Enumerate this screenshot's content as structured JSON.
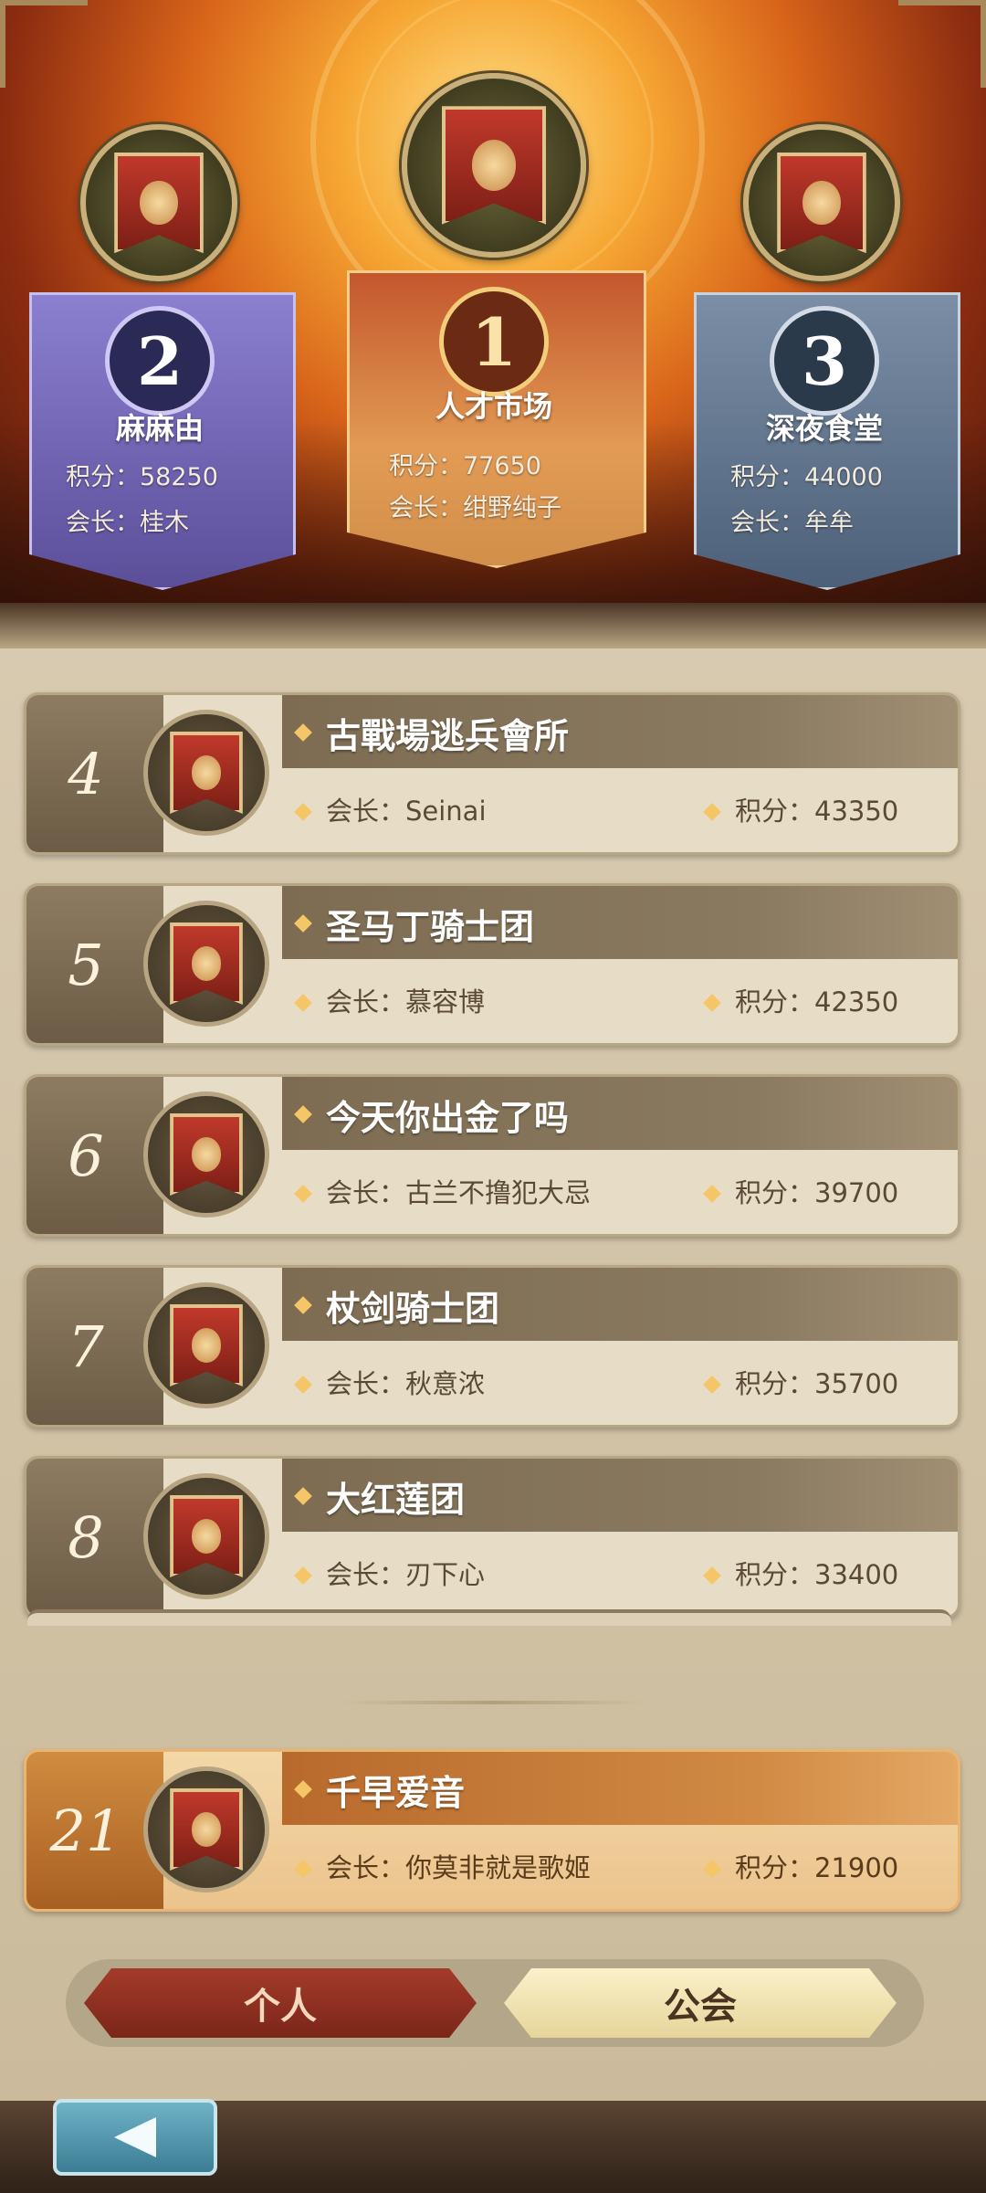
{
  "podium": [
    {
      "rank": "2",
      "name": "麻麻由",
      "score_label": "积分：58250",
      "leader_label": "会长：桂木"
    },
    {
      "rank": "1",
      "name": "人才市场",
      "score_label": "积分：77650",
      "leader_label": "会长：绀野纯子"
    },
    {
      "rank": "3",
      "name": "深夜食堂",
      "score_label": "积分：44000",
      "leader_label": "会长：牟牟"
    }
  ],
  "rows": [
    {
      "rank": "4",
      "name": "古戰場逃兵會所",
      "leader_label": "会长：Seinai",
      "score_label": "积分：43350"
    },
    {
      "rank": "5",
      "name": "圣马丁骑士团",
      "leader_label": "会长：慕容博",
      "score_label": "积分：42350"
    },
    {
      "rank": "6",
      "name": "今天你出金了吗",
      "leader_label": "会长：古兰不撸犯大忌",
      "score_label": "积分：39700"
    },
    {
      "rank": "7",
      "name": "杖剑骑士团",
      "leader_label": "会长：秋意浓",
      "score_label": "积分：35700"
    },
    {
      "rank": "8",
      "name": "大红莲团",
      "leader_label": "会长：刃下心",
      "score_label": "积分：33400"
    }
  ],
  "my_guild": {
    "rank": "21",
    "name": "千早爱音",
    "leader_label": "会长：你莫非就是歌姬",
    "score_label": "积分：21900"
  },
  "tabs": {
    "personal": "个人",
    "guild": "公会",
    "active": "公会"
  },
  "colors": {
    "first_place": "#e29b55",
    "second_place": "#8b7fd0",
    "third_place": "#7b8ea6",
    "own_row": "#ecc38c"
  },
  "icons": {
    "guild_emblem": "banner-crest-icon",
    "back": "back-arrow-icon"
  }
}
